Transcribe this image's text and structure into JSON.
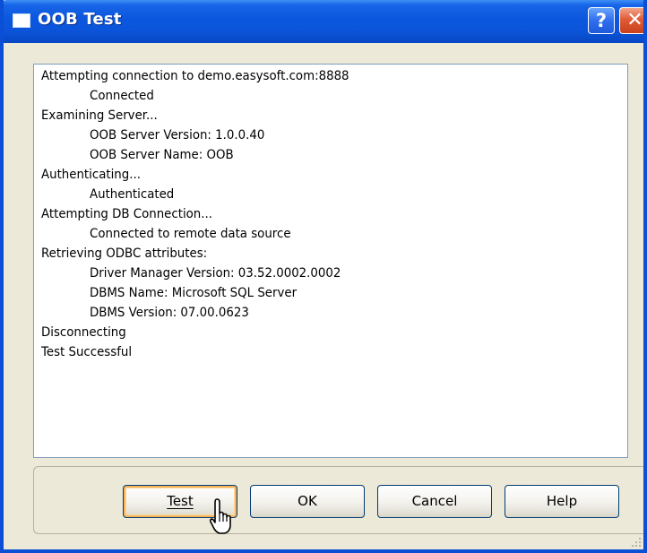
{
  "window": {
    "title": "OOB Test",
    "help_glyph": "?",
    "close_glyph": "✕",
    "colors": {
      "titlebar": "#0a56dd",
      "face": "#ece9d8",
      "focus_ring": "#f5b35c"
    }
  },
  "log": {
    "lines": [
      "Attempting connection to demo.easysoft.com:8888",
      "Connected",
      "Examining Server...",
      "OOB Server Version: 1.0.0.40",
      "OOB Server Name: OOB",
      "Authenticating...",
      "Authenticated",
      "Attempting DB Connection...",
      "Connected to remote data source",
      "Retrieving ODBC attributes:",
      "Driver Manager Version: 03.52.0002.0002",
      "DBMS Name: Microsoft SQL Server",
      "DBMS Version: 07.00.0623",
      "Disconnecting",
      "Test Successful"
    ]
  },
  "buttons": {
    "test_label": "Test",
    "ok_label": "OK",
    "cancel_label": "Cancel",
    "help_label": "Help"
  }
}
